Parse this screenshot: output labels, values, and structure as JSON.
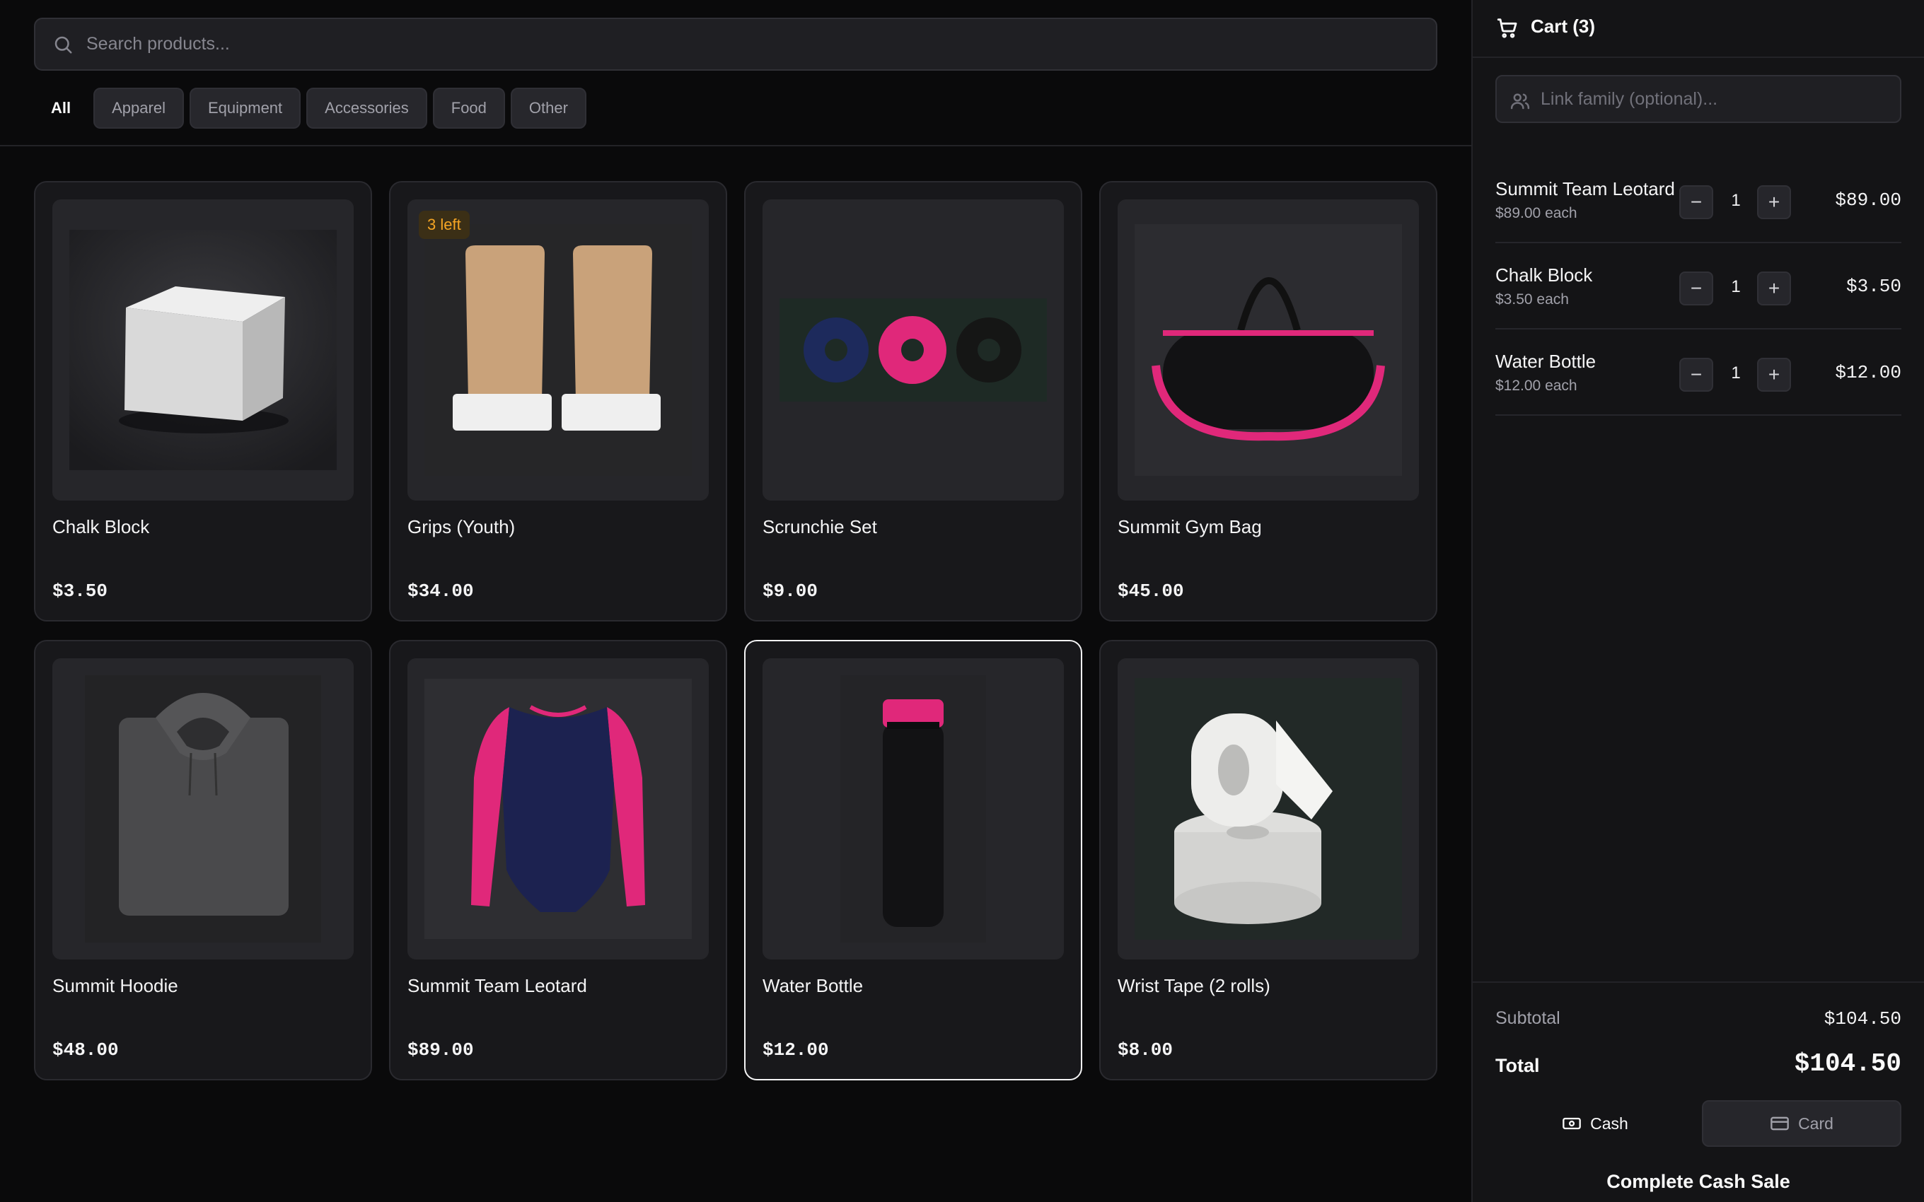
{
  "search": {
    "placeholder": "Search products..."
  },
  "categories": [
    {
      "label": "All",
      "active": true
    },
    {
      "label": "Apparel"
    },
    {
      "label": "Equipment"
    },
    {
      "label": "Accessories"
    },
    {
      "label": "Food"
    },
    {
      "label": "Other"
    }
  ],
  "products": [
    {
      "name": "Chalk Block",
      "price": "$3.50",
      "icon": "chalk-block-image"
    },
    {
      "name": "Grips (Youth)",
      "price": "$34.00",
      "badge": "3 left",
      "icon": "grips-image"
    },
    {
      "name": "Scrunchie Set",
      "price": "$9.00",
      "icon": "scrunchie-image"
    },
    {
      "name": "Summit Gym Bag",
      "price": "$45.00",
      "icon": "gym-bag-image"
    },
    {
      "name": "Summit Hoodie",
      "price": "$48.00",
      "icon": "hoodie-image"
    },
    {
      "name": "Summit Team Leotard",
      "price": "$89.00",
      "icon": "leotard-image"
    },
    {
      "name": "Water Bottle",
      "price": "$12.00",
      "icon": "water-bottle-image",
      "selected": true
    },
    {
      "name": "Wrist Tape (2 rolls)",
      "price": "$8.00",
      "icon": "wrist-tape-image"
    }
  ],
  "cart": {
    "title": "Cart (3)",
    "family_placeholder": "Link family (optional)...",
    "items": [
      {
        "name": "Summit Team Leotard",
        "each": "$89.00 each",
        "qty": "1",
        "total": "$89.00"
      },
      {
        "name": "Chalk Block",
        "each": "$3.50 each",
        "qty": "1",
        "total": "$3.50"
      },
      {
        "name": "Water Bottle",
        "each": "$12.00 each",
        "qty": "1",
        "total": "$12.00"
      }
    ],
    "minus": "−",
    "plus": "+",
    "subtotal_label": "Subtotal",
    "subtotal": "$104.50",
    "total_label": "Total",
    "total": "$104.50",
    "cash_label": "Cash",
    "card_label": "Card",
    "complete_label": "Complete Cash Sale"
  },
  "colors": {
    "accent": "#ec4899",
    "badge": "#f5a524",
    "background": "#0a0a0b",
    "panel": "#141416"
  }
}
